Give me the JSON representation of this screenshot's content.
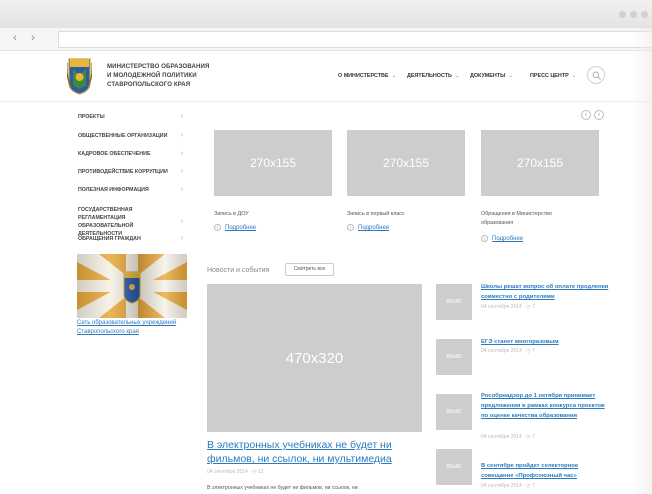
{
  "browser": {
    "back": "‹",
    "forward": "›"
  },
  "header": {
    "ministry_lines": [
      "МИНИСТЕРСТВО ОБРАЗОВАНИЯ",
      "И МОЛОДЕЖНОЙ ПОЛИТИКИ",
      "СТАВРОПОЛЬСКОГО КРАЯ"
    ],
    "nav": [
      "О МИНИСТЕРСТВЕ",
      "ДЕЯТЕЛЬНОСТЬ",
      "ДОКУМЕНТЫ",
      "ПРЕСС ЦЕНТР"
    ],
    "caret": "⌄"
  },
  "sidebar": {
    "items": [
      {
        "label": "ПРОЕКТЫ"
      },
      {
        "label": "ОБЩЕСТВЕННЫЕ ОРГАНИЗАЦИИ"
      },
      {
        "label": "КАДРОВОЕ ОБЕСПЕЧЕНИЕ"
      },
      {
        "label": "ПРОТИВОДЕЙСТВИЕ КОРРУПЦИИ"
      },
      {
        "label": "ПОЛЕЗНАЯ ИНФОРМАЦИЯ"
      },
      {
        "label": "ГОСУДАРСТВЕННАЯ РЕГЛАМЕНТАЦИЯ ОБРАЗОВАТЕЛЬНОЙ ДЕЯТЕЛЬНОСТИ"
      },
      {
        "label": "ОБРАЩЕНИЯ ГРАЖДАН"
      }
    ],
    "chevron": "›",
    "flag_link": "Сеть образовательных учреждений Ставропольского края"
  },
  "carousel": {
    "prev": "‹",
    "next": "›"
  },
  "cards": [
    {
      "img": "270x155",
      "caption": "Запись в ДОУ",
      "more": "Подробнее"
    },
    {
      "img": "270x155",
      "caption": "Запись в первый класс",
      "more": "Подробнее"
    },
    {
      "img": "270x155",
      "caption": "Обращения в Министерство образования",
      "more": "Подробнее"
    }
  ],
  "news": {
    "title": "Новости и события",
    "see_all": "Смотреть все",
    "big": {
      "img": "470x320",
      "headline": "В электронных учебниках не будет ни фильмов, ни ссылок, ни мультимедиа",
      "meta": "04 сентября 2014  ·  ◷ 12",
      "excerpt": "В электронных учебниках не будет ни фильмов, ни ссылок, ни"
    },
    "items": [
      {
        "img": "80x80",
        "title": "Школы решат вопрос об оплате продленки совместно с родителями",
        "meta": "04 сентября 2014  ·  ◷ 7"
      },
      {
        "img": "80x80",
        "title": "ЕГЭ станет многоразовым",
        "meta": "04 сентября 2014  ·  ◷ 7"
      },
      {
        "img": "80x80",
        "title": "Рособрнадзор до 1 октября принимает предложения в рамках конкурса проектов по оценке качества образования",
        "meta": "04 сентября 2014  ·  ◷ 7"
      },
      {
        "img": "80x80",
        "title": "В сентябре пройдет селекторное совещание «Профсоюзный час»",
        "meta": "04 сентября 2014  ·  ◷ 7"
      }
    ]
  },
  "colors": {
    "link": "#2a7bc0",
    "placeholder": "#cdcdcd",
    "flag_yellow": "#e9a93a"
  }
}
